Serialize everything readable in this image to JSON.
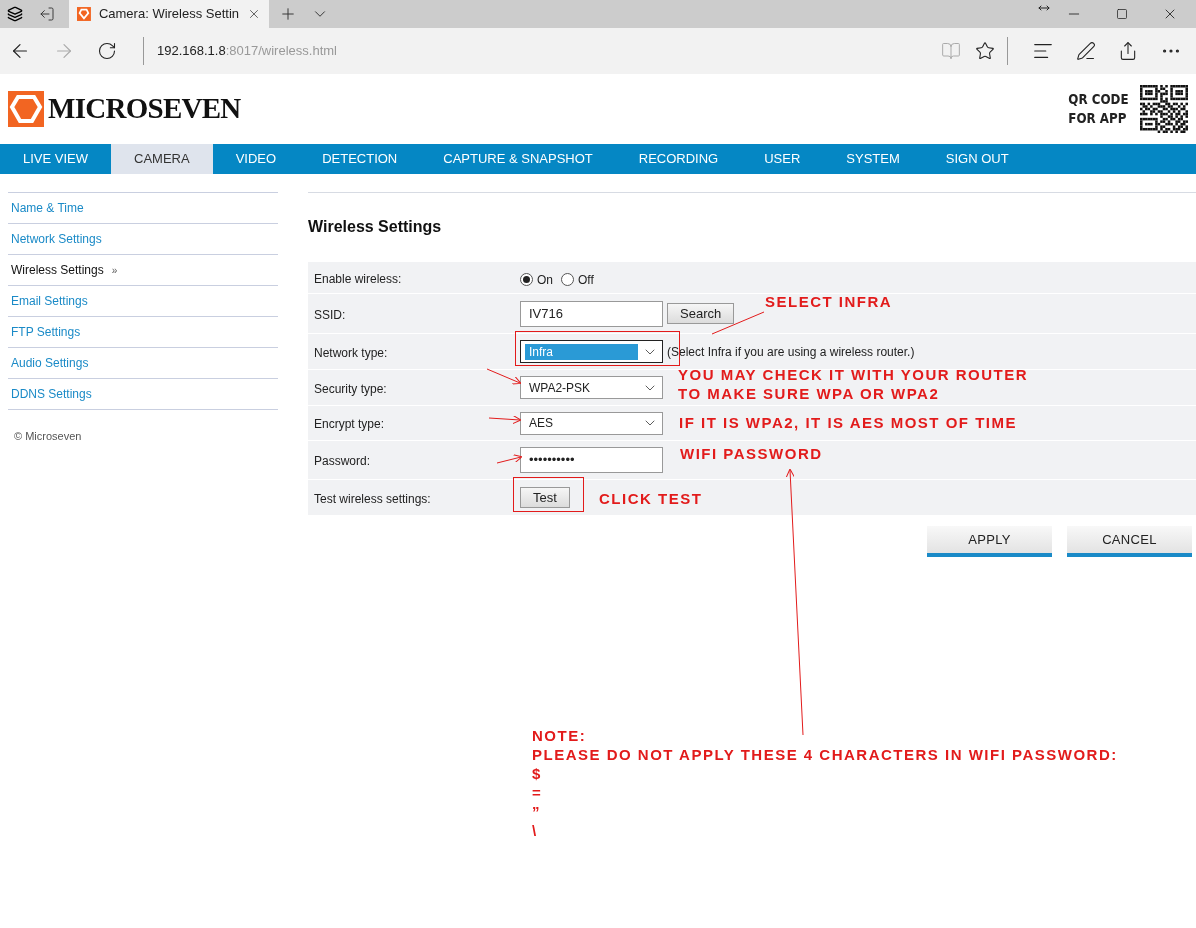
{
  "browser": {
    "tab_title": "Camera: Wireless Settin",
    "url_host": "192.168.1.8",
    "url_path": ":8017/wireless.html"
  },
  "header": {
    "logo_text": "MICROSEVEN",
    "qr_caption": [
      "QR CODE",
      "FOR APP"
    ]
  },
  "nav": [
    {
      "label": "LIVE VIEW",
      "selected": false
    },
    {
      "label": "CAMERA",
      "selected": true
    },
    {
      "label": "VIDEO",
      "selected": false
    },
    {
      "label": "DETECTION",
      "selected": false
    },
    {
      "label": "CAPTURE & SNAPSHOT",
      "selected": false
    },
    {
      "label": "RECORDING",
      "selected": false
    },
    {
      "label": "USER",
      "selected": false
    },
    {
      "label": "SYSTEM",
      "selected": false
    },
    {
      "label": "SIGN OUT",
      "selected": false
    }
  ],
  "sidebar": {
    "current_marker": "»",
    "items": [
      {
        "label": "Name & Time",
        "selected": false
      },
      {
        "label": "Network Settings",
        "selected": false
      },
      {
        "label": "Wireless Settings",
        "selected": true
      },
      {
        "label": "Email Settings",
        "selected": false
      },
      {
        "label": "FTP Settings",
        "selected": false
      },
      {
        "label": "Audio Settings",
        "selected": false
      },
      {
        "label": "DDNS Settings",
        "selected": false
      }
    ],
    "footer": "© Microseven"
  },
  "form": {
    "title": "Wireless Settings",
    "rows": [
      {
        "kind": "radio",
        "label": "Enable wireless:",
        "options": [
          {
            "label": "On",
            "selected": true
          },
          {
            "label": "Off",
            "selected": false
          }
        ]
      },
      {
        "kind": "text",
        "label": "SSID:",
        "value": "IV716",
        "button": "Search"
      },
      {
        "kind": "select",
        "label": "Network type:",
        "value": "Infra",
        "highlighted": true,
        "hint": "(Select Infra if you are using a wireless router.)"
      },
      {
        "kind": "select",
        "label": "Security type:",
        "value": "WPA2-PSK",
        "highlighted": false
      },
      {
        "kind": "select",
        "label": "Encrypt type:",
        "value": "AES",
        "highlighted": false
      },
      {
        "kind": "text",
        "label": "Password:",
        "value": "••••••••••"
      },
      {
        "kind": "button",
        "label": "Test wireless settings:",
        "button": "Test"
      }
    ]
  },
  "actions": [
    "APPLY",
    "CANCEL"
  ],
  "annotations": [
    {
      "lines": [
        "SELECT INFRA"
      ]
    },
    {
      "lines": [
        "YOU MAY CHECK IT WITH YOUR ROUTER",
        "TO MAKE SURE WPA OR WPA2"
      ]
    },
    {
      "lines": [
        "IF IT IS WPA2, IT IS AES MOST OF TIME"
      ]
    },
    {
      "lines": [
        "WIFI PASSWORD"
      ]
    },
    {
      "lines": [
        "CLICK TEST"
      ]
    },
    {
      "lines": [
        "NOTE:",
        "PLEASE DO NOT APPLY THESE 4 CHARACTERS IN WIFI PASSWORD:",
        "$",
        "=",
        "”",
        "\\"
      ]
    }
  ]
}
